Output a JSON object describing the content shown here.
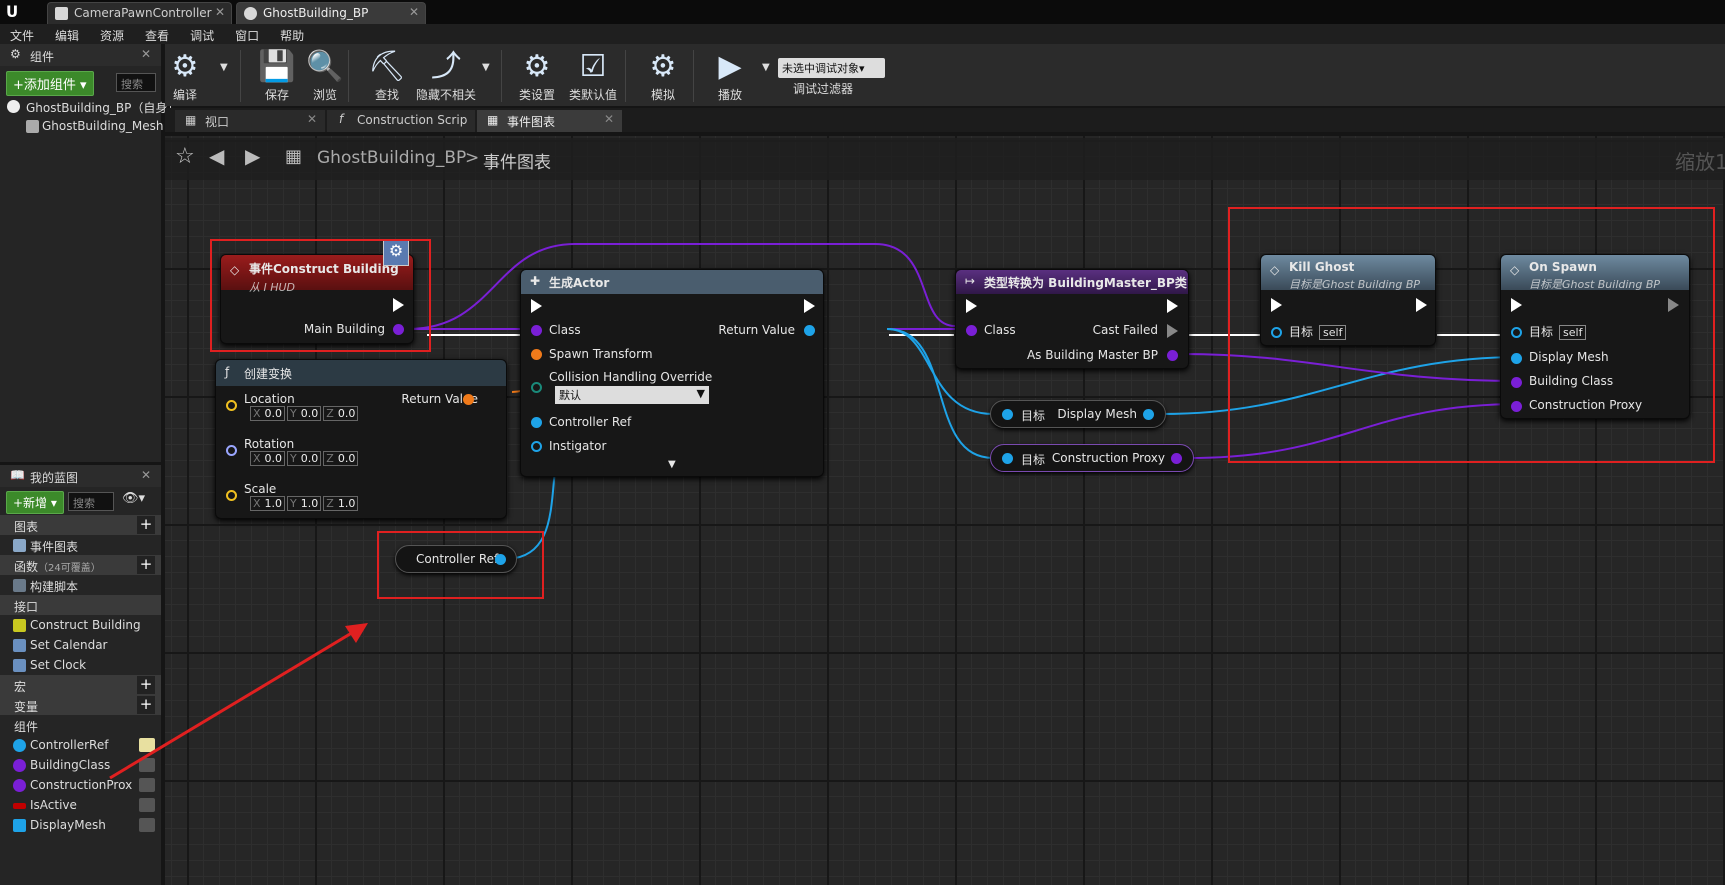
{
  "doc_tabs": [
    {
      "label": "CameraPawnController"
    },
    {
      "label": "GhostBuilding_BP"
    }
  ],
  "menu": [
    "文件",
    "编辑",
    "资源",
    "查看",
    "调试",
    "窗口",
    "帮助"
  ],
  "components_panel": {
    "title": "组件",
    "add_button": "+添加组件 ▾",
    "search_placeholder": "搜索",
    "items": [
      "GhostBuilding_BP（自身）",
      "GhostBuilding_Mesh"
    ]
  },
  "toolbar": {
    "buttons": [
      {
        "label": "编译",
        "icon": "compile-icon"
      },
      {
        "label": "保存",
        "icon": "save-icon"
      },
      {
        "label": "浏览",
        "icon": "browse-icon"
      },
      {
        "label": "查找",
        "icon": "find-icon"
      },
      {
        "label": "隐藏不相关",
        "icon": "hide-unrelated-icon"
      },
      {
        "label": "类设置",
        "icon": "class-settings-icon"
      },
      {
        "label": "类默认值",
        "icon": "class-defaults-icon"
      },
      {
        "label": "模拟",
        "icon": "simulate-icon"
      },
      {
        "label": "播放",
        "icon": "play-icon"
      }
    ],
    "debug_select": "未选中调试对象▾",
    "debug_filter_label": "调试过滤器"
  },
  "editor_tabs": [
    {
      "label": "视口"
    },
    {
      "label": "Construction Scrip"
    },
    {
      "label": "事件图表"
    }
  ],
  "breadcrumb": {
    "root": "GhostBuilding_BP",
    "separator": ">",
    "current": "事件图表",
    "zoom": "缩放1"
  },
  "my_blueprint": {
    "title": "我的蓝图",
    "new_button": "+新增 ▾",
    "search_placeholder": "搜索",
    "sections": {
      "graphs": "图表",
      "event_graph": "事件图表",
      "functions": "函数",
      "functions_note": "（24可覆盖）",
      "construction_script": "构建脚本",
      "interfaces": "接口",
      "macros": "宏",
      "variables": "变量",
      "components": "组件"
    },
    "interface_items": [
      "Construct Building",
      "Set Calendar",
      "Set Clock"
    ],
    "variables": [
      {
        "name": "ControllerRef",
        "color": "#1ea3e8"
      },
      {
        "name": "BuildingClass",
        "color": "#7a1fd6"
      },
      {
        "name": "ConstructionProx",
        "color": "#7a1fd6"
      },
      {
        "name": "IsActive",
        "color": "#c00000"
      },
      {
        "name": "DisplayMesh",
        "color": "#1ea3e8"
      }
    ]
  },
  "nodes": {
    "event": {
      "title": "事件Construct Building",
      "subtitle": "从 I HUD",
      "pin_out": "Main Building"
    },
    "make_transform": {
      "title": "创建变换",
      "location": "Location",
      "rotation": "Rotation",
      "scale": "Scale",
      "return": "Return Value",
      "loc": [
        "0.0",
        "0.0",
        "0.0"
      ],
      "rot": [
        "0.0",
        "0.0",
        "0.0"
      ],
      "scl": [
        "1.0",
        "1.0",
        "1.0"
      ]
    },
    "spawn": {
      "title": "生成Actor",
      "class": "Class",
      "spawn_transform": "Spawn Transform",
      "collision": "Collision Handling Override",
      "collision_value": "默认",
      "controller_ref": "Controller Ref",
      "instigator": "Instigator",
      "return": "Return Value"
    },
    "cast": {
      "title": "类型转换为 BuildingMaster_BP类",
      "class": "Class",
      "cast_failed": "Cast Failed",
      "as_master": "As Building Master BP"
    },
    "display_mesh": {
      "target": "目标",
      "label": "Display Mesh"
    },
    "construction_proxy": {
      "target": "目标",
      "label": "Construction Proxy"
    },
    "kill_ghost": {
      "title": "Kill Ghost",
      "subtitle": "目标是Ghost Building BP",
      "target": "目标",
      "self": "self"
    },
    "on_spawn": {
      "title": "On Spawn",
      "subtitle": "目标是Ghost Building BP",
      "target": "目标",
      "self": "self",
      "display_mesh": "Display Mesh",
      "building_class": "Building Class",
      "construction_proxy": "Construction Proxy"
    },
    "controller_ref_var": {
      "label": "Controller Ref"
    }
  },
  "axis_labels": [
    "X",
    "Y",
    "Z"
  ],
  "colors": {
    "exec": "#ffffff",
    "object": "#1ea3e8",
    "class": "#7a1fd6",
    "struct": "#f07a1a",
    "vector": "#f0c020",
    "rotator": "#9aa6ff",
    "event_header": "#8a1a1a",
    "function_header": "#5a7286",
    "cast_header": "#4d2a6a",
    "annotation": "#e02020"
  }
}
